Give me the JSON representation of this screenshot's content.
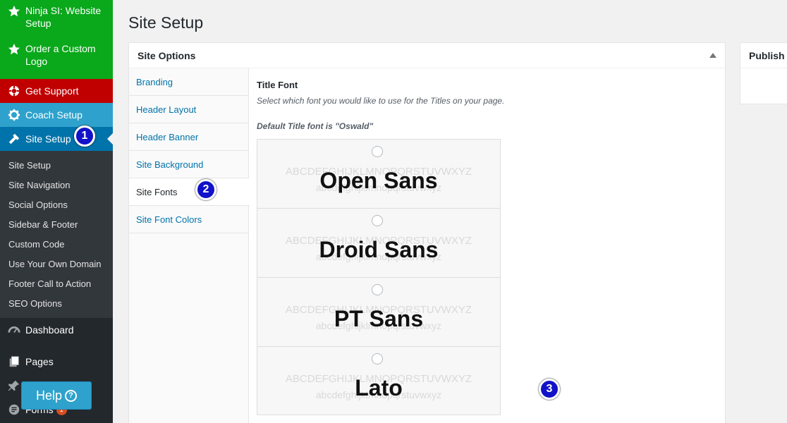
{
  "sidebar": {
    "top_items": [
      {
        "label": "Ninja SI: Website Setup",
        "icon": "star-icon"
      },
      {
        "label": "Order a Custom Logo",
        "icon": "star-icon"
      },
      {
        "label": "Get Support",
        "icon": "lifebuoy-icon"
      },
      {
        "label": "Coach Setup",
        "icon": "gear-icon"
      },
      {
        "label": "Site Setup",
        "icon": "hammer-icon"
      }
    ],
    "submenu": [
      "Site Setup",
      "Site Navigation",
      "Social Options",
      "Sidebar & Footer",
      "Custom Code",
      "Use Your Own Domain",
      "Footer Call to Action",
      "SEO Options"
    ],
    "bottom_items": [
      {
        "label": "Dashboard",
        "icon": "dashboard-icon"
      },
      {
        "label": "Pages",
        "icon": "pages-icon"
      },
      {
        "label": "",
        "icon": "pin-icon"
      },
      {
        "label": "Forms",
        "icon": "forms-icon",
        "badge": "1"
      }
    ]
  },
  "help": {
    "label": "Help",
    "icon": "question-circle-icon"
  },
  "callouts": [
    "1",
    "2",
    "3"
  ],
  "page": {
    "title": "Site Setup"
  },
  "panel": {
    "title": "Site Options",
    "tabs": [
      "Branding",
      "Header Layout",
      "Header Banner",
      "Site Background",
      "Site Fonts",
      "Site Font Colors"
    ],
    "active_tab": "Site Fonts"
  },
  "field": {
    "title": "Title Font",
    "description": "Select which font you would like to use for the Titles on your page.",
    "default_note": "Default Title font is \"Oswald\"",
    "ghost_upper": "ABCDEFGHIJKLMNOPQRSTUVWXYZ",
    "ghost_lower": "abcdefghijklmnopqrstuvwxyz",
    "options": [
      "Open Sans",
      "Droid Sans",
      "PT Sans",
      "Lato"
    ]
  },
  "publish": {
    "title": "Publish"
  },
  "colors": {
    "green": "#0aa81b",
    "red": "#c00000",
    "coach": "#2ea2cc",
    "active": "#0073aa",
    "callout": "#1212c9"
  }
}
